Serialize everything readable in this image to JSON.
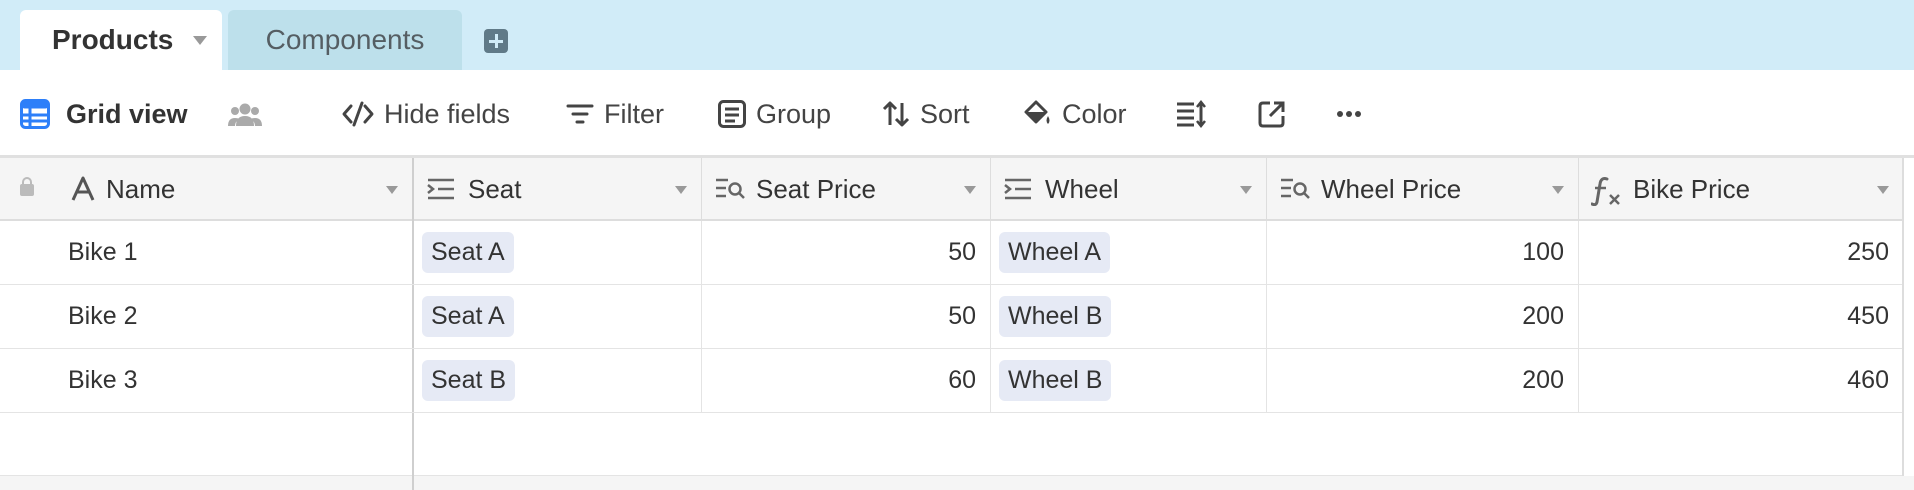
{
  "tabs": [
    {
      "label": "Products",
      "active": true
    },
    {
      "label": "Components",
      "active": false
    }
  ],
  "toolbar": {
    "view_name": "Grid view",
    "hide_fields": "Hide fields",
    "filter": "Filter",
    "group": "Group",
    "sort": "Sort",
    "color": "Color",
    "more": "···"
  },
  "columns": [
    {
      "label": "Name",
      "icon": "text-field-icon"
    },
    {
      "label": "Seat",
      "icon": "link-field-icon"
    },
    {
      "label": "Seat Price",
      "icon": "lookup-field-icon"
    },
    {
      "label": "Wheel",
      "icon": "link-field-icon"
    },
    {
      "label": "Wheel Price",
      "icon": "lookup-field-icon"
    },
    {
      "label": "Bike Price",
      "icon": "formula-field-icon"
    }
  ],
  "rows": [
    {
      "name": "Bike 1",
      "seat": "Seat A",
      "seat_price": "50",
      "wheel": "Wheel A",
      "wheel_price": "100",
      "bike_price": "250"
    },
    {
      "name": "Bike 2",
      "seat": "Seat A",
      "seat_price": "50",
      "wheel": "Wheel B",
      "wheel_price": "200",
      "bike_price": "450"
    },
    {
      "name": "Bike 3",
      "seat": "Seat B",
      "seat_price": "60",
      "wheel": "Wheel B",
      "wheel_price": "200",
      "bike_price": "460"
    }
  ],
  "colors": {
    "tab_bar": "#d1ecf8",
    "view_icon": "#2d7ff9",
    "pill": "#e6eaf5"
  }
}
